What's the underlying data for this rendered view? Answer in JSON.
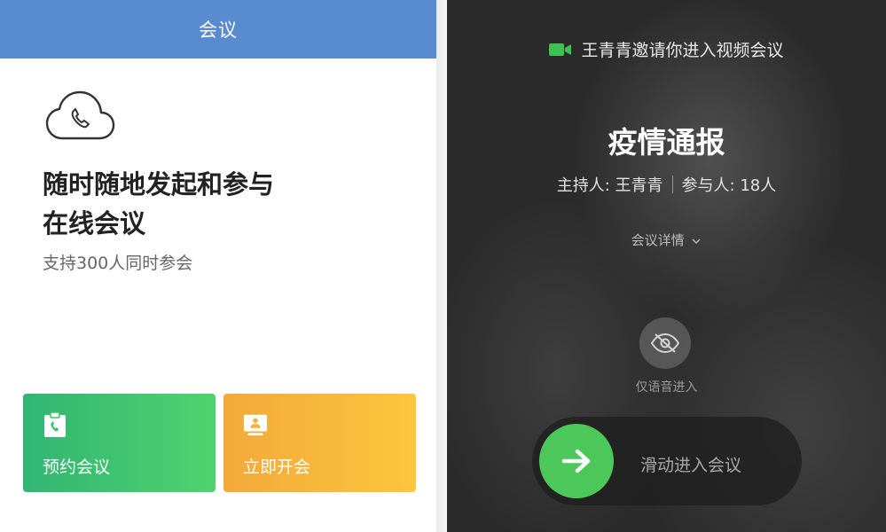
{
  "left_panel": {
    "header_title": "会议",
    "headline_line1": "随时随地发起和参与",
    "headline_line2": "在线会议",
    "subtitle": "支持300人同时参会",
    "cards": [
      {
        "label": "预约会议",
        "icon": "schedule-phone-icon",
        "color_start": "#31b574",
        "color_end": "#4fd36e"
      },
      {
        "label": "立即开会",
        "icon": "presentation-icon",
        "color_start": "#f3a93a",
        "color_end": "#fcc63d"
      }
    ],
    "accent": "#588bd0"
  },
  "right_panel": {
    "invite_text": "王青青邀请你进入视频会议",
    "meeting_title": "疫情通报",
    "host_text": "主持人: 王青青",
    "participants_text": "参与人: 18人",
    "details_label": "会议详情",
    "audio_only_label": "仅语音进入",
    "slide_label": "滑动进入会议",
    "accent_green": "#4cc85a"
  }
}
